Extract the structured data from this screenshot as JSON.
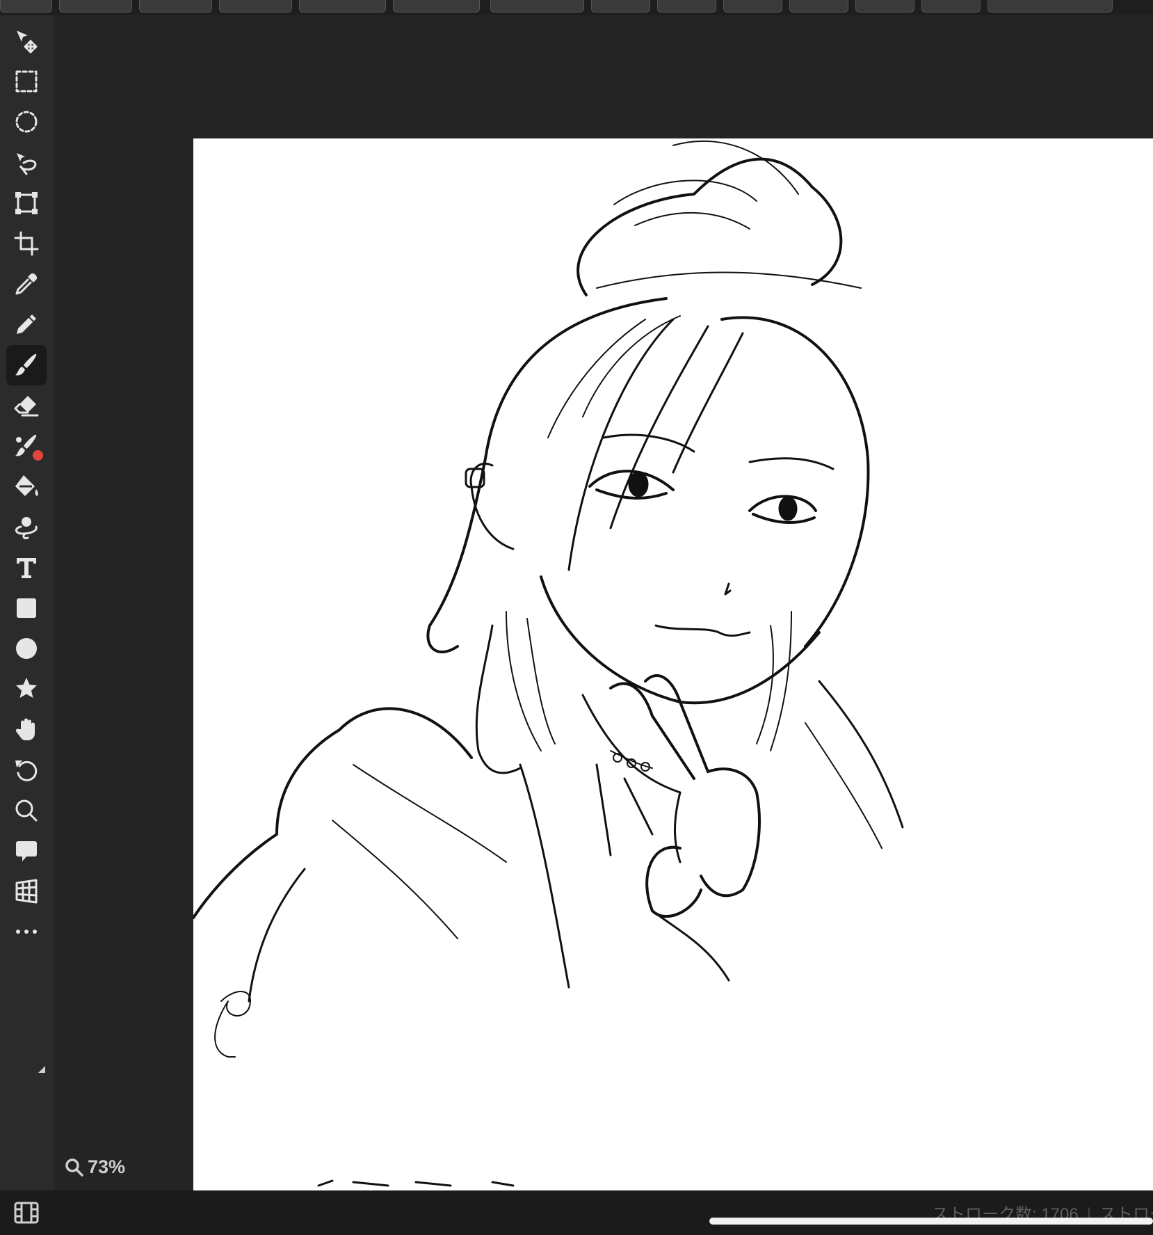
{
  "app": {
    "zoom_level": "73%",
    "status": {
      "stroke_count": "ストローク数: 1706",
      "stroke_truncated": "ストロー"
    },
    "accent_colors": {
      "badge": "#e5443c",
      "panel": "#2b2b2b",
      "canvas": "#ffffff"
    }
  },
  "tools": [
    {
      "name": "move-tool",
      "icon": "move-arrow-icon"
    },
    {
      "name": "rect-select-tool",
      "icon": "rect-select-icon"
    },
    {
      "name": "ellipse-select-tool",
      "icon": "ellipse-select-icon"
    },
    {
      "name": "lasso-tool",
      "icon": "lasso-icon"
    },
    {
      "name": "transform-tool",
      "icon": "transform-icon"
    },
    {
      "name": "crop-tool",
      "icon": "crop-icon"
    },
    {
      "name": "eyedropper-tool",
      "icon": "eyedropper-icon"
    },
    {
      "name": "pencil-tool",
      "icon": "pencil-icon"
    },
    {
      "name": "brush-tool",
      "icon": "brush-icon",
      "active": true
    },
    {
      "name": "eraser-tool",
      "icon": "eraser-icon"
    },
    {
      "name": "blend-brush-tool",
      "icon": "blend-brush-icon",
      "badge": true
    },
    {
      "name": "fill-tool",
      "icon": "paint-bucket-icon"
    },
    {
      "name": "magic-lasso-tool",
      "icon": "magic-lasso-icon"
    },
    {
      "name": "text-tool",
      "icon": "text-icon"
    },
    {
      "name": "rectangle-tool",
      "icon": "rectangle-icon"
    },
    {
      "name": "ellipse-tool",
      "icon": "circle-icon"
    },
    {
      "name": "star-tool",
      "icon": "star-icon"
    },
    {
      "name": "hand-tool",
      "icon": "hand-icon"
    },
    {
      "name": "rotate-tool",
      "icon": "rotate-icon"
    },
    {
      "name": "zoom-tool",
      "icon": "magnifier-icon"
    },
    {
      "name": "speech-bubble-tool",
      "icon": "speech-bubble-icon"
    },
    {
      "name": "perspective-tool",
      "icon": "perspective-grid-icon"
    },
    {
      "name": "more-tools",
      "icon": "more-icon"
    }
  ]
}
